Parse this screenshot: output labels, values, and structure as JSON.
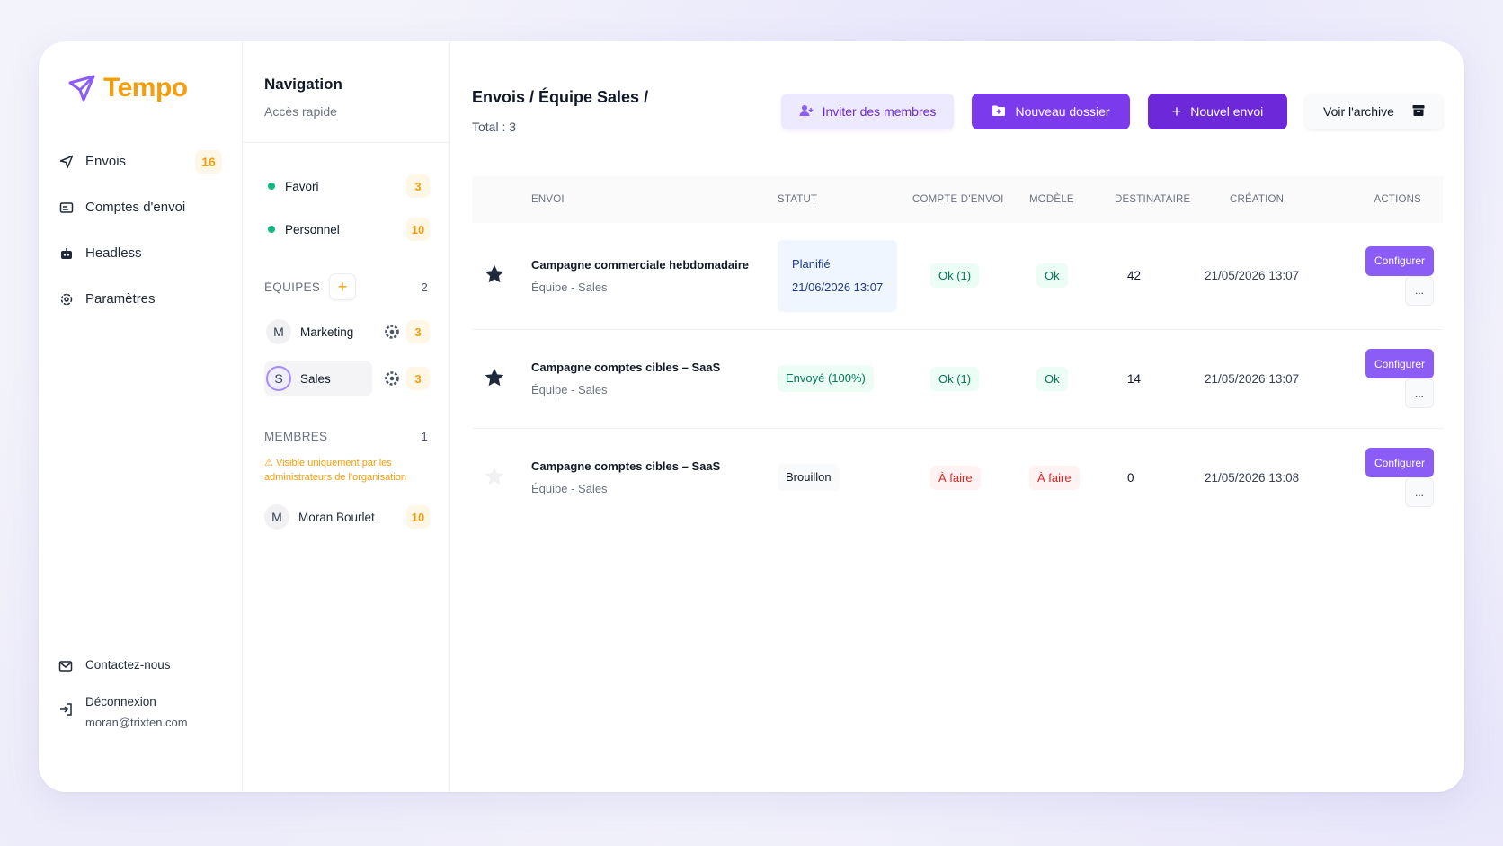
{
  "brand": {
    "name": "Tempo",
    "color": "#f59e0b",
    "accent": "#7c3aed"
  },
  "sidebar": {
    "items": [
      {
        "label": "Envois",
        "icon": "send-icon",
        "count": "16"
      },
      {
        "label": "Comptes d'envoi",
        "icon": "accounts-icon",
        "count": ""
      },
      {
        "label": "Headless",
        "icon": "robot-icon",
        "count": ""
      },
      {
        "label": "Paramètres",
        "icon": "gear-icon",
        "count": ""
      }
    ],
    "contact": "Contactez-nous",
    "logout": "Déconnexion",
    "email": "moran@trixten.com"
  },
  "navpanel": {
    "title": "Navigation",
    "subtitle": "Accès rapide",
    "quick": [
      {
        "label": "Favori",
        "count": "3"
      },
      {
        "label": "Personnel",
        "count": "10"
      }
    ],
    "teams_label": "ÉQUIPES",
    "teams_count": "2",
    "teams": [
      {
        "initial": "M",
        "label": "Marketing",
        "count": "3"
      },
      {
        "initial": "S",
        "label": "Sales",
        "count": "3"
      }
    ],
    "members_label": "MEMBRES",
    "members_count": "1",
    "members_warning": "Visible uniquement par les administrateurs de l'organisation",
    "members": [
      {
        "initial": "M",
        "label": "Moran Bourlet",
        "count": "10"
      }
    ]
  },
  "main": {
    "breadcrumb": "Envois / Équipe Sales /",
    "total": "Total : 3",
    "buttons": {
      "invite": "Inviter des membres",
      "folder": "Nouveau dossier",
      "new": "Nouvel envoi",
      "archive": "Voir l'archive"
    },
    "columns": [
      "ENVOI",
      "STATUT",
      "COMPTE D'ENVOI",
      "MODÈLE",
      "DESTINATAIRE",
      "CRÉATION",
      "ACTIONS"
    ],
    "rows": [
      {
        "starred": true,
        "title": "Campagne commerciale hebdomadaire",
        "team": "Équipe - Sales",
        "status": "Planifié",
        "status_date": "21/06/2026 13:07",
        "account": "Ok (1)",
        "model": "Ok",
        "recipients": "42",
        "created": "21/05/2026 13:07",
        "config": "Configurer",
        "more": "..."
      },
      {
        "starred": true,
        "title": "Campagne comptes cibles – SaaS",
        "team": "Équipe - Sales",
        "status": "Envoyé (100%)",
        "status_date": "",
        "account": "Ok (1)",
        "model": "Ok",
        "recipients": "14",
        "created": "21/05/2026 13:07",
        "config": "Configurer",
        "more": "..."
      },
      {
        "starred": false,
        "title": "Campagne comptes cibles – SaaS",
        "team": "Équipe - Sales",
        "status": "Brouillon",
        "status_date": "",
        "account": "À faire",
        "model": "À faire",
        "recipients": "0",
        "created": "21/05/2026 13:08",
        "config": "Configurer",
        "more": "..."
      }
    ]
  }
}
